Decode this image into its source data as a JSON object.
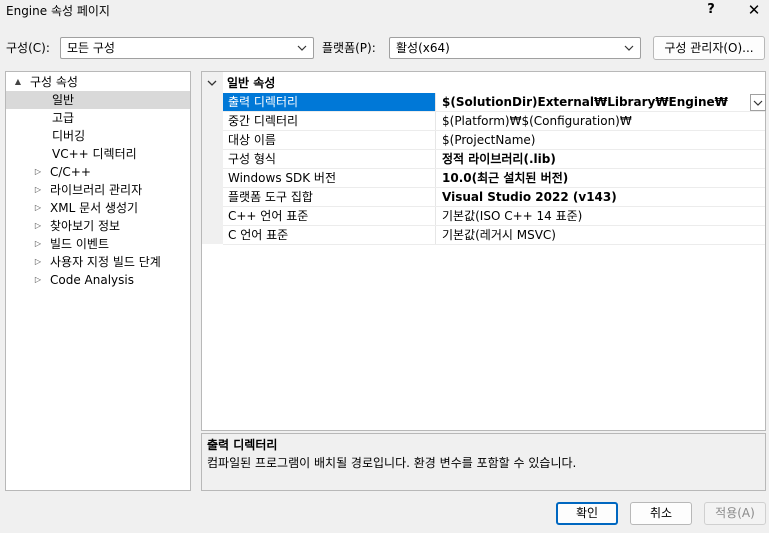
{
  "window": {
    "title": "Engine 속성 페이지",
    "help_label": "?",
    "close_label": "✕"
  },
  "toolbar": {
    "config_label": "구성(C):",
    "config_value": "모든 구성",
    "platform_label": "플랫폼(P):",
    "platform_value": "활성(x64)",
    "config_manager_label": "구성 관리자(O)..."
  },
  "tree": {
    "root": "구성 속성",
    "items": [
      {
        "label": "일반",
        "expandable": false,
        "selected": true
      },
      {
        "label": "고급",
        "expandable": false
      },
      {
        "label": "디버깅",
        "expandable": false
      },
      {
        "label": "VC++ 디렉터리",
        "expandable": false
      },
      {
        "label": "C/C++",
        "expandable": true
      },
      {
        "label": "라이브러리 관리자",
        "expandable": true
      },
      {
        "label": "XML 문서 생성기",
        "expandable": true
      },
      {
        "label": "찾아보기 정보",
        "expandable": true
      },
      {
        "label": "빌드 이벤트",
        "expandable": true
      },
      {
        "label": "사용자 지정 빌드 단계",
        "expandable": true
      },
      {
        "label": "Code Analysis",
        "expandable": true
      }
    ]
  },
  "grid": {
    "category": "일반 속성",
    "properties": [
      {
        "name": "출력 디렉터리",
        "value": "$(SolutionDir)External₩Library₩Engine₩",
        "bold": true,
        "selected": true
      },
      {
        "name": "중간 디렉터리",
        "value": "$(Platform)₩$(Configuration)₩",
        "bold": false
      },
      {
        "name": "대상 이름",
        "value": "$(ProjectName)",
        "bold": false
      },
      {
        "name": "구성 형식",
        "value": "정적 라이브러리(.lib)",
        "bold": true
      },
      {
        "name": "Windows SDK 버전",
        "value": "10.0(최근 설치된 버전)",
        "bold": true
      },
      {
        "name": "플랫폼 도구 집합",
        "value": "Visual Studio 2022 (v143)",
        "bold": true
      },
      {
        "name": "C++ 언어 표준",
        "value": "기본값(ISO C++ 14 표준)",
        "bold": false
      },
      {
        "name": "C 언어 표준",
        "value": "기본값(레거시 MSVC)",
        "bold": false
      }
    ]
  },
  "description": {
    "title": "출력 디렉터리",
    "text": "컴파일된 프로그램이 배치될 경로입니다. 환경 변수를 포함할 수 있습니다."
  },
  "buttons": {
    "ok": "확인",
    "cancel": "취소",
    "apply": "적용(A)"
  },
  "colors": {
    "selection": "#0078d7",
    "tree_selection": "#d9d9d9",
    "default_button_border": "#0067c0"
  },
  "icons": {
    "expanded": "▲",
    "collapsed": "▷",
    "dropdown": "chevron-down-icon",
    "category_expanded": "chevron-down-icon"
  }
}
